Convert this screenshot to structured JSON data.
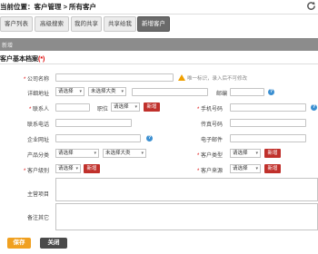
{
  "location": {
    "text": "当前位置：客户管理 > 所有客户"
  },
  "tabs": [
    {
      "label": "客户列表",
      "active": false
    },
    {
      "label": "高级搜索",
      "active": false
    },
    {
      "label": "我的共享",
      "active": false
    },
    {
      "label": "共享给我",
      "active": false
    },
    {
      "label": "新增客户",
      "active": true
    }
  ],
  "grey_bar": {
    "label": "新增"
  },
  "section": {
    "title": "客户基本档案",
    "required_mark": "(*)"
  },
  "form": {
    "company_name": {
      "label": "公司名称",
      "hint": "唯一标识，录入后不可修改"
    },
    "address": {
      "label": "详细地址",
      "province": "请选择",
      "city": "未选择大类",
      "zip_label": "邮编"
    },
    "contact": {
      "label": "联系人",
      "position_label": "职位",
      "position_value": "请选择",
      "new_btn": "新增"
    },
    "mobile": {
      "label": "手机号码"
    },
    "tel": {
      "label": "联系电话"
    },
    "fax": {
      "label": "传真号码"
    },
    "website": {
      "label": "企业网址"
    },
    "email": {
      "label": "电子邮件"
    },
    "product": {
      "label": "产品分类",
      "value1": "请选择",
      "value2": "未选择大类"
    },
    "customer_type": {
      "label": "客户类型",
      "value": "请选择",
      "new_btn": "新增"
    },
    "level": {
      "label": "客户级别",
      "value": "请选择",
      "new_btn": "新增"
    },
    "source": {
      "label": "客户来源",
      "value": "请选择",
      "new_btn": "新增"
    },
    "main_items": {
      "label": "主营项目"
    },
    "notes": {
      "label": "备注其它"
    }
  },
  "buttons": {
    "save": "保存",
    "close": "关闭"
  },
  "colors": {
    "active_tab": "#6b6b6b",
    "save_btn": "#f0a020",
    "close_btn": "#4a4a4a",
    "red_btn": "#c0302b"
  }
}
